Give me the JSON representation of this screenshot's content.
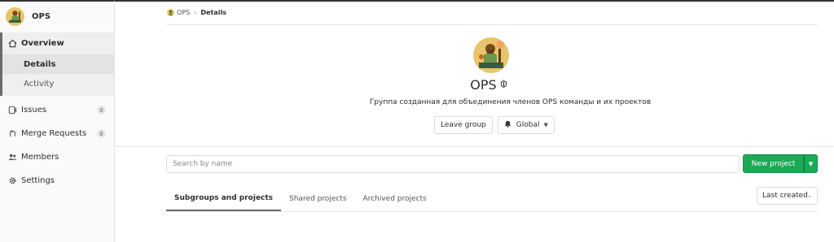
{
  "sidebar": {
    "group_name": "OPS",
    "overview": "Overview",
    "details": "Details",
    "activity": "Activity",
    "issues": {
      "label": "Issues",
      "count": "0"
    },
    "merge_requests": {
      "label": "Merge Requests",
      "count": "0"
    },
    "members": "Members",
    "settings": "Settings"
  },
  "breadcrumb": {
    "group": "OPS",
    "separator": "›",
    "current": "Details"
  },
  "group": {
    "title": "OPS",
    "visibility_icon": "shield-icon",
    "description": "Группа созданная для объединения членов OPS команды и их проектов"
  },
  "actions": {
    "leave_group": "Leave group",
    "notification": "Global"
  },
  "search": {
    "placeholder": "Search by name"
  },
  "new_project": "New project",
  "tabs": [
    "Subgroups and projects",
    "Shared projects",
    "Archived projects"
  ],
  "sort": "Last created",
  "colors": {
    "primary_button": "#1aaa55",
    "active_indicator": "#6b6b6b"
  }
}
